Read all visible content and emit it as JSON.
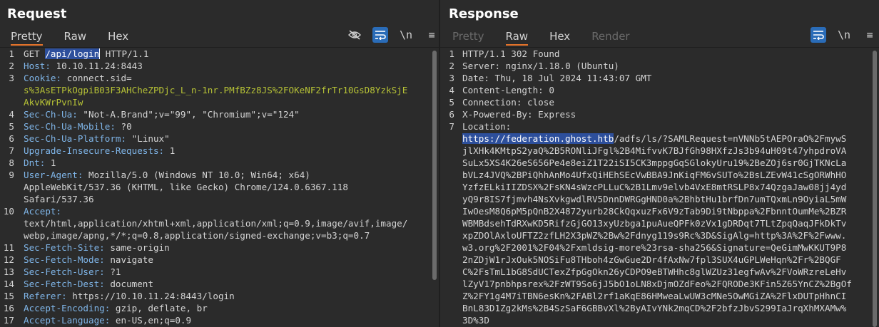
{
  "request": {
    "title": "Request",
    "tabs": [
      "Pretty",
      "Raw",
      "Hex"
    ],
    "active_tab": "Pretty",
    "tools": {
      "eye_off": "eye-off-icon",
      "wrap": "wrap-icon",
      "newline": "\\n",
      "menu": "≡"
    },
    "method": "GET",
    "path": "/api/login",
    "protocol": "HTTP/1.1",
    "headers": [
      {
        "name": "Host:",
        "value": "10.10.11.24:8443"
      },
      {
        "name": "Cookie:",
        "value": "connect.sid=",
        "cookie_lines": [
          "s%3AsETPkOgpiB03F3AHCheZPDjc_L_n-1nr.PMfBZz8JS%2FOKeNF2frTr10GsD8YzkSjE",
          "AkvKWrPvnIw"
        ]
      },
      {
        "name": "Sec-Ch-Ua:",
        "value": "\"Not-A.Brand\";v=\"99\", \"Chromium\";v=\"124\""
      },
      {
        "name": "Sec-Ch-Ua-Mobile:",
        "value": "?0"
      },
      {
        "name": "Sec-Ch-Ua-Platform:",
        "value": "\"Linux\""
      },
      {
        "name": "Upgrade-Insecure-Requests:",
        "value": "1"
      },
      {
        "name": "Dnt:",
        "value": "1"
      },
      {
        "name": "User-Agent:",
        "value": "Mozilla/5.0 (Windows NT 10.0; Win64; x64)",
        "cont": [
          "AppleWebKit/537.36 (KHTML, like Gecko) Chrome/124.0.6367.118",
          "Safari/537.36"
        ]
      },
      {
        "name": "Accept:",
        "value": "",
        "cont": [
          "text/html,application/xhtml+xml,application/xml;q=0.9,image/avif,image/",
          "webp,image/apng,*/*;q=0.8,application/signed-exchange;v=b3;q=0.7"
        ]
      },
      {
        "name": "Sec-Fetch-Site:",
        "value": "same-origin"
      },
      {
        "name": "Sec-Fetch-Mode:",
        "value": "navigate"
      },
      {
        "name": "Sec-Fetch-User:",
        "value": "?1"
      },
      {
        "name": "Sec-Fetch-Dest:",
        "value": "document"
      },
      {
        "name": "Referer:",
        "value": "https://10.10.11.24:8443/login"
      },
      {
        "name": "Accept-Encoding:",
        "value": "gzip, deflate, br"
      },
      {
        "name": "Accept-Language:",
        "value": "en-US,en;q=0.9"
      }
    ]
  },
  "response": {
    "title": "Response",
    "tabs": [
      "Pretty",
      "Raw",
      "Hex",
      "Render"
    ],
    "active_tab": "Raw",
    "status": "HTTP/1.1 302 Found",
    "headers": [
      {
        "name": "Server:",
        "value": "nginx/1.18.0 (Ubuntu)"
      },
      {
        "name": "Date:",
        "value": "Thu, 18 Jul 2024 11:43:07 GMT"
      },
      {
        "name": "Content-Length:",
        "value": "0"
      },
      {
        "name": "Connection:",
        "value": "close"
      },
      {
        "name": "X-Powered-By:",
        "value": "Express"
      },
      {
        "name": "Location:",
        "value": ""
      }
    ],
    "location_host": "https://federation.ghost.htb",
    "location_lines": [
      "/adfs/ls/?SAMLRequest=nVNNb5tAEPOraO%2FmywS",
      "jlXHk4KMtpS2yaQ%2B5RONliJFgl%2B4MifvvK7BJfGh98HXfzJs3b94uH09t47yhpdroVA",
      "SuLx5XS4K26eS656Pe4e8eiZ1T22iSI5CK3mppgGqSGlokyUru19%2BeZOj6sr0GjTKNcLa",
      "bVLz4JVQ%2BPiQhhAnMo4UfxQiHEhSEcVwBBA9JnKiqFM6vSUTo%2BsLZEvW41cSgORWhHO",
      "YzfzELkiIIZDSX%2FsKN4sWzcPLLuC%2B1Lmv9elvb4VxE8mtRSLP8x74QzgaJaw08jj4yd",
      "yQ9r8IS7fjmvh4NsXvkgwdlRV5DnnDWRGgHND0a%2BhbtHu1brfDn7umTQxmLn9OyiaL5mW",
      "IwOesM8Q6pM5pQnB2X4872yurb28CkQqxuzFx6V9zTab9Di9tNbppa%2FbnntOumMe%2BZR",
      "WBMBdsehTdRXwKD5RifzGjGO13xyUzbga1puAueQPFk0zVx1gDRDqt7TLtZpqQaqJFkDkTv",
      "xpZDOlAxloUFTZ2zfLH2X3pWZ%2Bw%2Fdnyg119s9Rc%3D&SigAlg=http%3A%2F%2Fwww.",
      "w3.org%2F2001%2F04%2Fxmldsig-more%23rsa-sha256&Signature=QeGimMwKKUT9P8",
      "2nZDjW1rJxOuk5NOSiFu8THboh4zGwGue2Dr4fAxNw7fpl3SUX4uGPLWeHqn%2Fr%2BQGF",
      "C%2FsTmL1bG8SdUCTexZfpGgOkn26yCDPO9eBTWHhc8glWZUz31egfwAv%2FVoWRzreLeHv",
      "lZyV17pnbhpsrex%2FzWT9So6jJ5bO1oLN8xDjmOZdFeo%2FQRODe3KFin5Z65YnCZ%2BgOf",
      "Z%2FY1g4M7iTBN6esKn%2FABl2rf1aKqE86HMweaLwUW3cMNe5OwMGiZA%2FlxDUTpHhnCI",
      "BnL83D1Zg2kMs%2B4SzSaF6GBBvXl%2ByAIvYNk2mqCD%2F2bfzJbvS299IaJrqXhMXAMw%",
      "3D%3D"
    ]
  }
}
